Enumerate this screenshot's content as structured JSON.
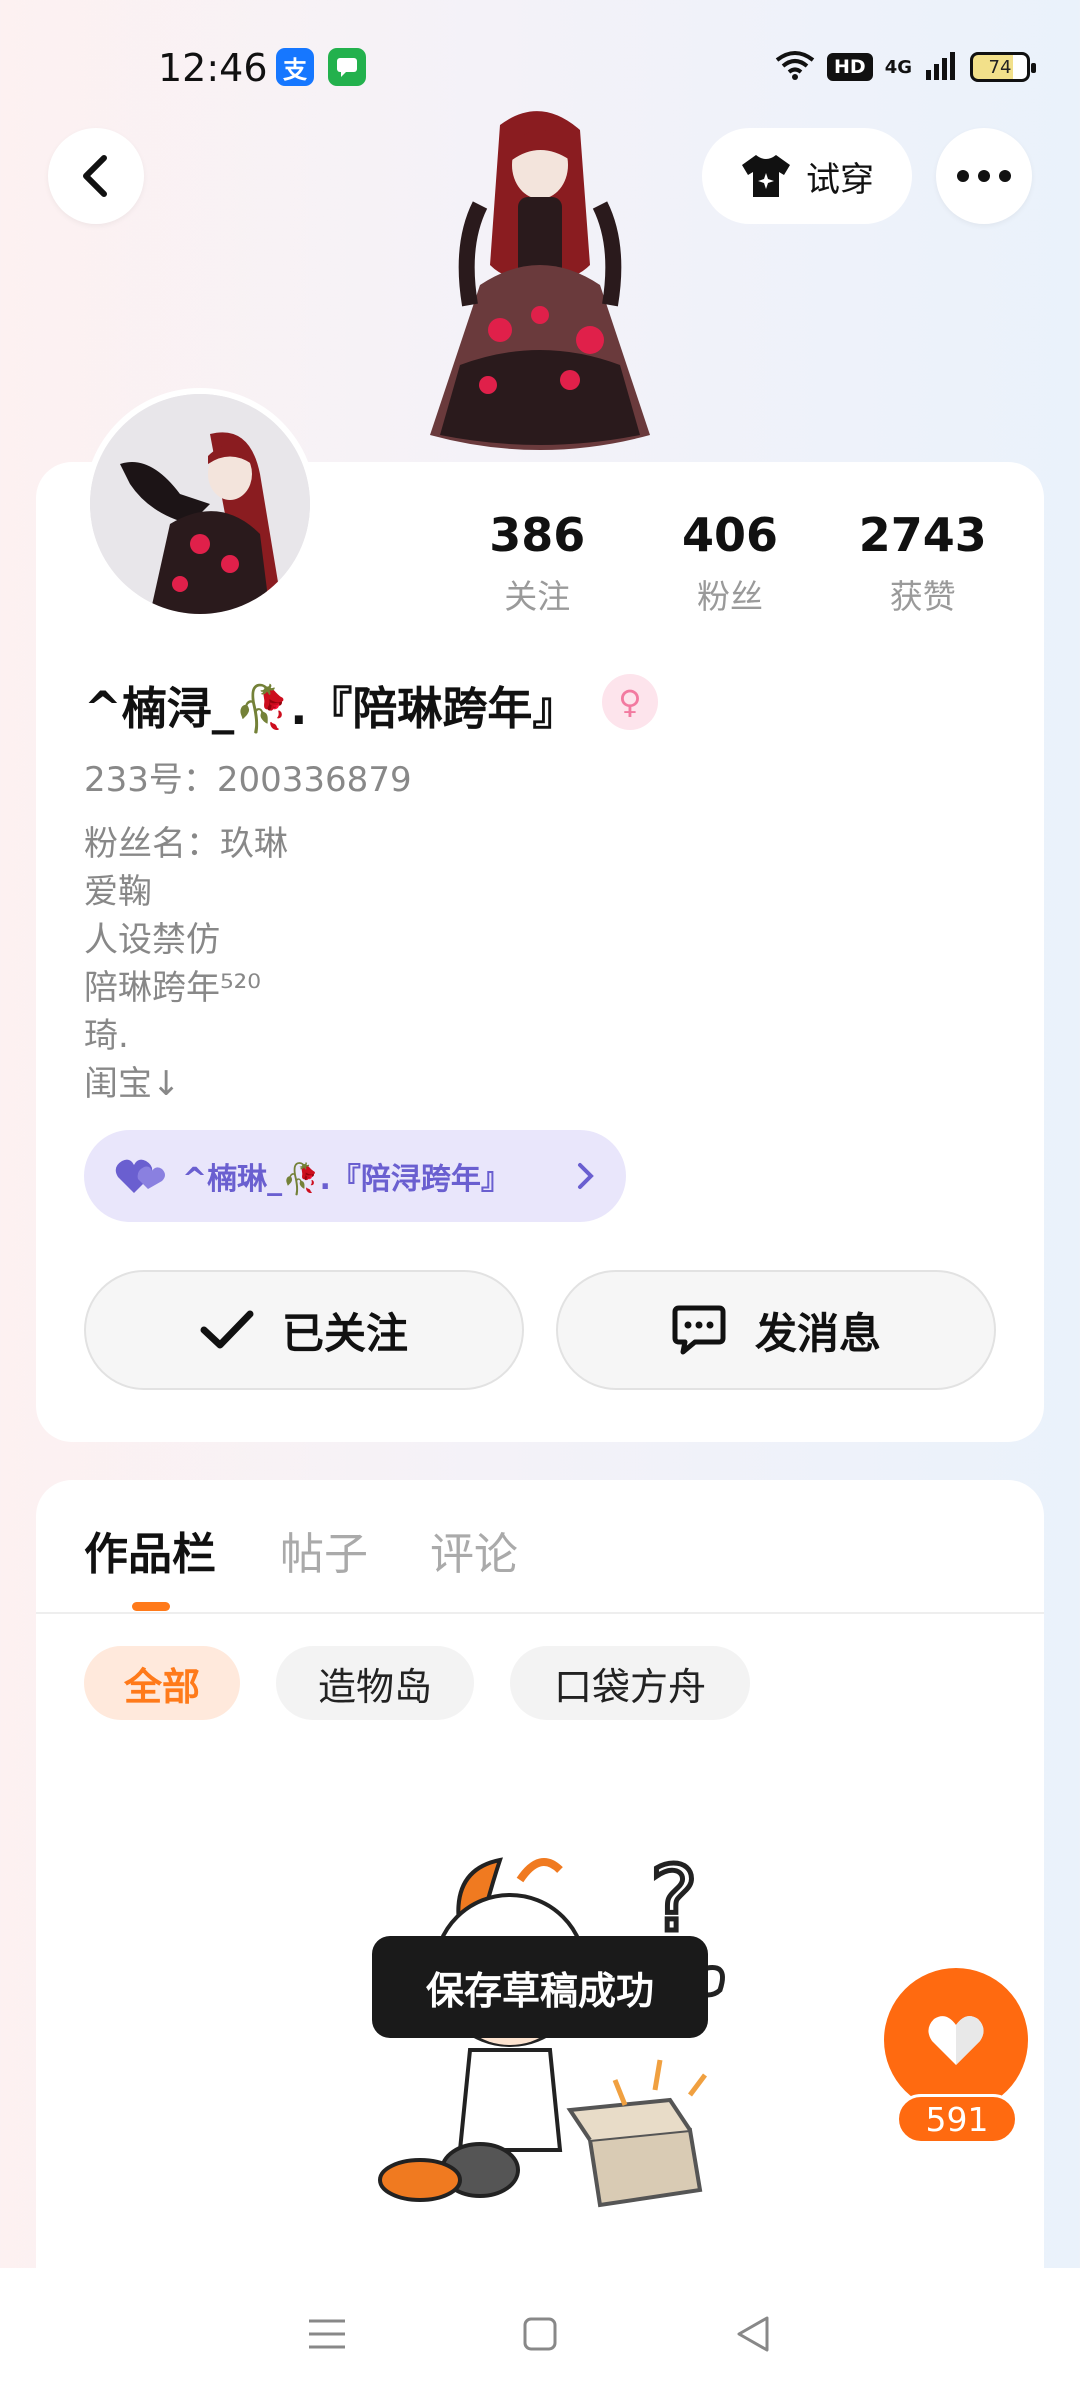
{
  "status_bar": {
    "time": "12:46",
    "alipay_glyph": "支",
    "network": "4G",
    "hd": "HD",
    "battery": "74"
  },
  "header": {
    "back_icon": "chevron-left-icon",
    "try_on_label": "试穿",
    "more_icon": "more-dots-icon"
  },
  "profile": {
    "stats": [
      {
        "value": "386",
        "label": "关注"
      },
      {
        "value": "406",
        "label": "粉丝"
      },
      {
        "value": "2743",
        "label": "获赞"
      }
    ],
    "nickname": "^楠浔_🥀.『陪琳跨年』",
    "gender": "♀",
    "uid": "233号：200336879",
    "bio_lines": [
      "粉丝名：玖琳",
      "爱鞠",
      "人设禁仿",
      "陪琳跨年⁵²⁰",
      "琦.",
      "闺宝↓"
    ],
    "linked_account": "^楠琳_🥀.『陪浔跨年』",
    "follow_label": "已关注",
    "message_label": "发消息"
  },
  "works": {
    "tabs": [
      "作品栏",
      "帖子",
      "评论"
    ],
    "active_tab": 0,
    "filters": [
      "全部",
      "造物岛",
      "口袋方舟"
    ],
    "active_filter": 0
  },
  "toast": "保存草稿成功",
  "like": {
    "count": "591"
  },
  "colors": {
    "accent": "#ff6a10",
    "link_pill": "#e9e6fb",
    "link_text": "#6a5fd0"
  }
}
